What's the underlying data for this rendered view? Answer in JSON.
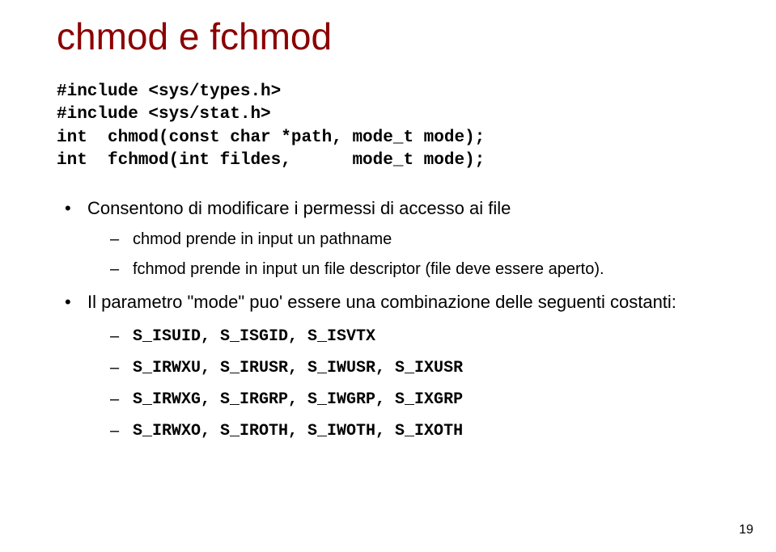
{
  "title": "chmod e fchmod",
  "code": {
    "l1": "#include <sys/types.h>",
    "l2": "#include <sys/stat.h>",
    "l3": "int  chmod(const char *path, mode_t mode);",
    "l4": "int  fchmod(int fildes,      mode_t mode);"
  },
  "bullets": {
    "b1": "Consentono di modificare i permessi di accesso ai file",
    "b1s1": "chmod prende in input un pathname",
    "b1s2": "fchmod prende in input un file descriptor (file deve essere aperto).",
    "b2": "Il parametro \"mode\" puo' essere una combinazione delle seguenti costanti:",
    "c1": "S_ISUID, S_ISGID, S_ISVTX",
    "c2": "S_IRWXU, S_IRUSR, S_IWUSR, S_IXUSR",
    "c3": "S_IRWXG, S_IRGRP, S_IWGRP, S_IXGRP",
    "c4": "S_IRWXO, S_IROTH, S_IWOTH, S_IXOTH"
  },
  "page": "19"
}
